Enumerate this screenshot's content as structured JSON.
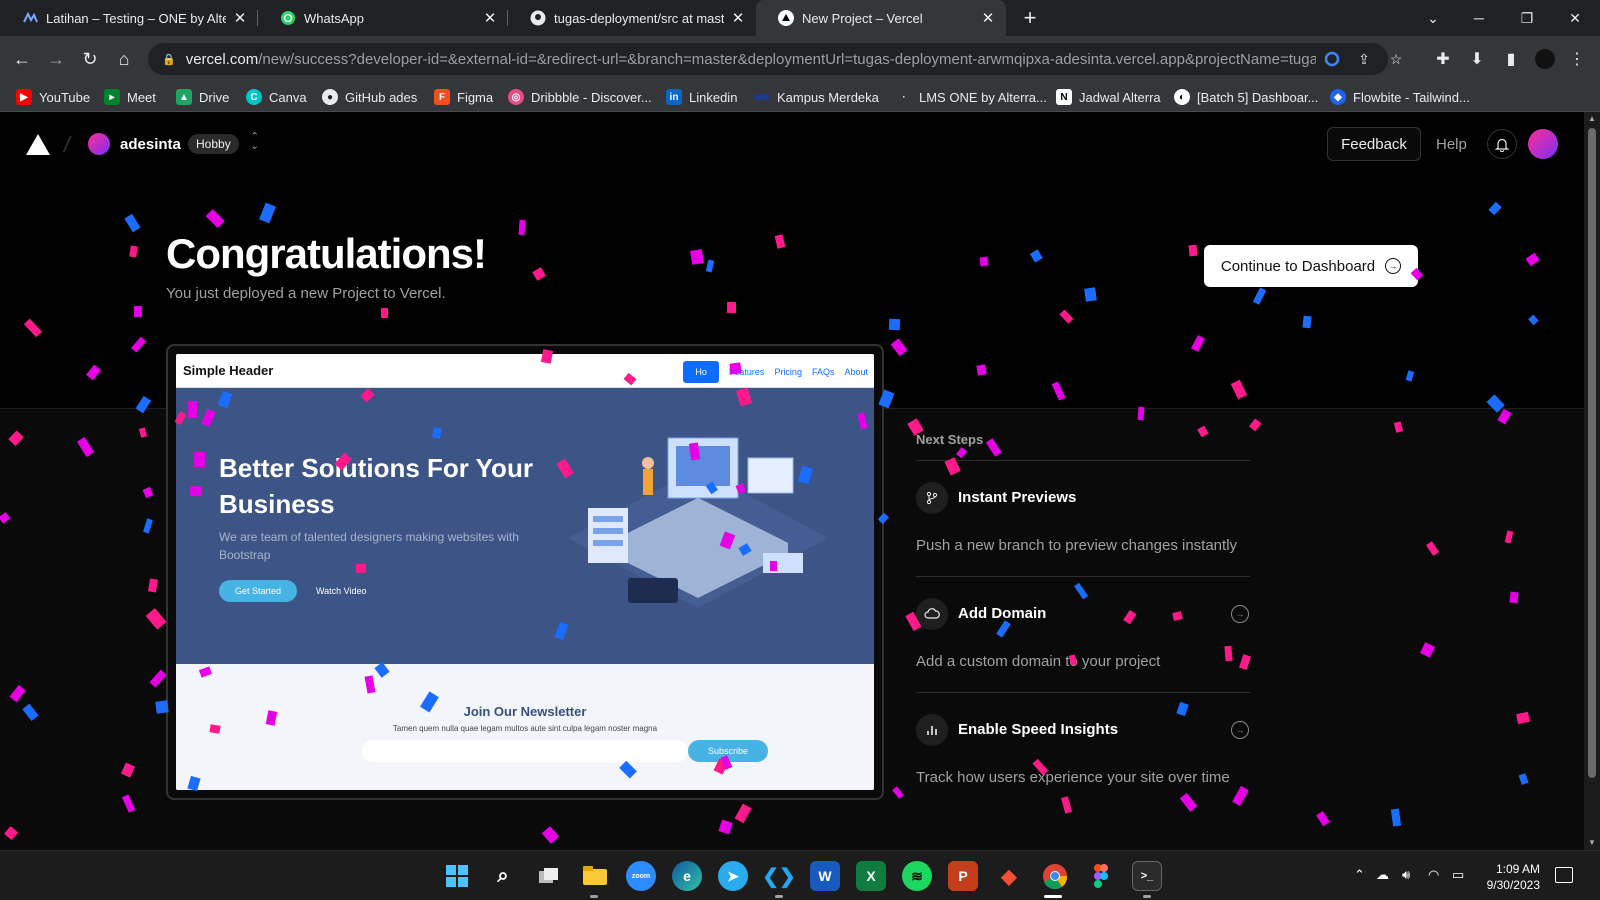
{
  "browser": {
    "tabs": [
      {
        "title": "Latihan – Testing – ONE by Alterra",
        "favicon": "alterra-icon",
        "active": false
      },
      {
        "title": "WhatsApp",
        "favicon": "whatsapp-icon",
        "active": false
      },
      {
        "title": "tugas-deployment/src at master",
        "favicon": "github-icon",
        "active": false
      },
      {
        "title": "New Project – Vercel",
        "favicon": "vercel-icon",
        "active": true
      }
    ],
    "url_host": "vercel.com",
    "url_path": "/new/success?developer-id=&external-id=&redirect-url=&branch=master&deploymentUrl=tugas-deployment-arwmqipxa-adesinta.vercel.app&projectName=tuga...",
    "bookmarks": [
      {
        "label": "YouTube",
        "color": "#ff0000"
      },
      {
        "label": "Meet",
        "color": "#00832d"
      },
      {
        "label": "Drive",
        "color": "#1fa463"
      },
      {
        "label": "Canva",
        "color": "#00c4cc"
      },
      {
        "label": "GitHub ades",
        "color": "#e8eaed"
      },
      {
        "label": "Figma",
        "color": "#f24e1e"
      },
      {
        "label": "Dribbble - Discover...",
        "color": "#ea4c89"
      },
      {
        "label": "Linkedin",
        "color": "#0a66c2"
      },
      {
        "label": "Kampus Merdeka",
        "color": "#1a3a8f"
      },
      {
        "label": "LMS ONE by Alterra...",
        "color": "#e8eaed"
      },
      {
        "label": "Jadwal Alterra",
        "color": "#ffffff"
      },
      {
        "label": "[Batch 5] Dashboar...",
        "color": "#ffffff"
      },
      {
        "label": "Flowbite - Tailwind...",
        "color": "#1c64f2"
      }
    ]
  },
  "header": {
    "team_name": "adesinta",
    "plan": "Hobby",
    "feedback_label": "Feedback",
    "help_label": "Help"
  },
  "hero": {
    "title": "Congratulations!",
    "subtitle": "You just deployed a new Project to Vercel.",
    "dashboard_button": "Continue to Dashboard"
  },
  "preview": {
    "brand": "Simple Header",
    "nav": [
      "Ho",
      "Features",
      "Pricing",
      "FAQs",
      "About"
    ],
    "headline": "Better Solutions For Your Business",
    "lead": "We are team of talented designers making websites with Bootstrap",
    "get_started": "Get Started",
    "watch_video": "Watch Video",
    "newsletter_title": "Join Our Newsletter",
    "newsletter_text": "Tamen quem nulla quae legam multos aute sint culpa legam noster magna",
    "subscribe": "Subscribe"
  },
  "next_steps": {
    "title": "Next Steps",
    "items": [
      {
        "name": "Instant Previews",
        "description": "Push a new branch to preview changes instantly",
        "icon": "git-branch-icon"
      },
      {
        "name": "Add Domain",
        "description": "Add a custom domain to your project",
        "icon": "cloud-icon"
      },
      {
        "name": "Enable Speed Insights",
        "description": "Track how users experience your site over time",
        "icon": "bar-chart-icon"
      }
    ]
  },
  "taskbar": {
    "time": "1:09 AM",
    "date": "9/30/2023",
    "apps": [
      "Start",
      "Search",
      "Task View",
      "File Explorer",
      "Zoom",
      "Edge",
      "Telegram",
      "VS Code",
      "Word",
      "Excel",
      "Spotify",
      "PowerPoint",
      "Git",
      "Chrome",
      "Figma",
      "Terminal"
    ]
  },
  "colors": {
    "confetti_pink": "#ff1a8c",
    "confetti_magenta": "#e600e6",
    "confetti_blue": "#1a6dff",
    "page_bg": "#000000"
  }
}
